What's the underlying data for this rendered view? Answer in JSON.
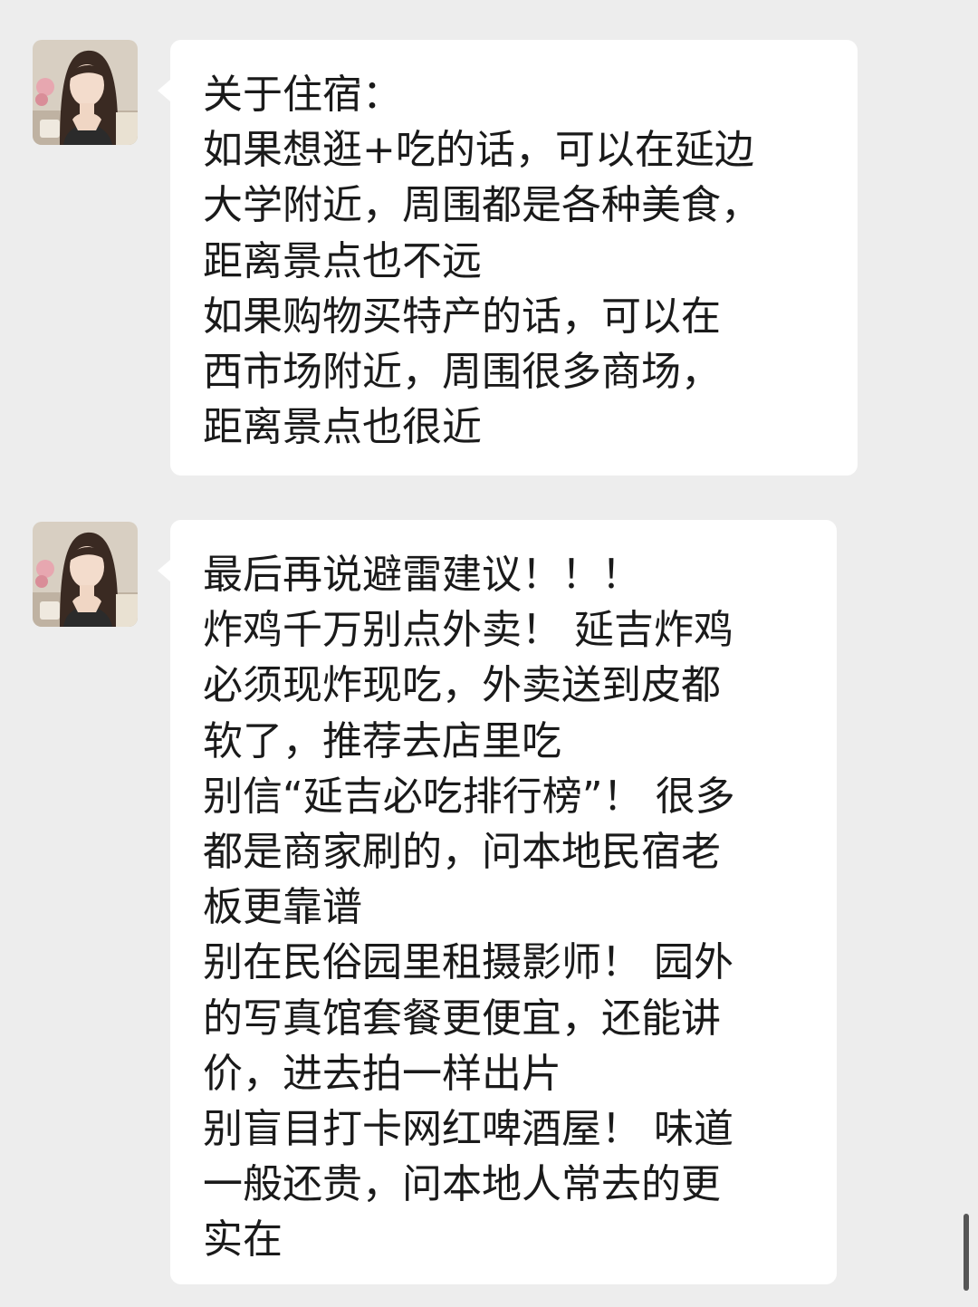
{
  "messages": [
    {
      "sender": "contact",
      "lines": [
        "关于住宿：",
        "如果想逛+吃的话，可以在延边",
        "大学附近，周围都是各种美食，",
        "距离景点也不远",
        "如果购物买特产的话，可以在",
        "西市场附近，周围很多商场，",
        "距离景点也很近"
      ]
    },
    {
      "sender": "contact",
      "lines": [
        "最后再说避雷建议！！！",
        "炸鸡千万别点外卖！ 延吉炸鸡",
        "必须现炸现吃，外卖送到皮都",
        "软了，推荐去店里吃",
        "别信“延吉必吃排行榜”！ 很多",
        "都是商家刷的，问本地民宿老",
        "板更靠谱",
        "别在民俗园里租摄影师！ 园外",
        "的写真馆套餐更便宜，还能讲",
        "价，进去拍一样出片",
        "别盲目打卡网红啤酒屋！ 味道",
        "一般还贵，问本地人常去的更",
        "实在"
      ]
    }
  ],
  "colors": {
    "background": "#ededed",
    "bubble": "#ffffff",
    "text": "#1a1a1a"
  }
}
